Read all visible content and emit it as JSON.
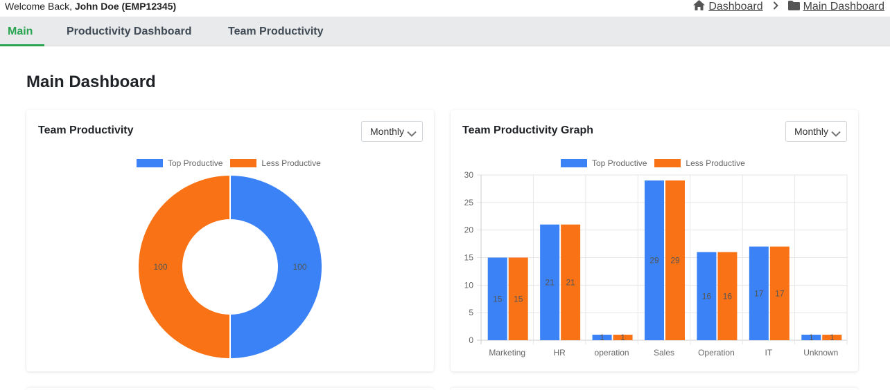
{
  "topbar": {
    "welcome_prefix": "Welcome Back,",
    "user": "John Doe (EMP12345)",
    "breadcrumb": [
      {
        "label": "Dashboard",
        "icon": "home-icon"
      },
      {
        "label": "Main Dashboard",
        "icon": "folder-icon"
      }
    ]
  },
  "tabs": [
    {
      "label": "Main",
      "active": true
    },
    {
      "label": "Productivity Dashboard",
      "active": false
    },
    {
      "label": "Team Productivity",
      "active": false
    }
  ],
  "page_title": "Main Dashboard",
  "colors": {
    "top": "#3b82f6",
    "less": "#f97316",
    "accent": "#2aa450"
  },
  "cards": {
    "donut": {
      "title": "Team Productivity",
      "period": "Monthly"
    },
    "bars": {
      "title": "Team Productivity Graph",
      "period": "Monthly"
    }
  },
  "chart_data": [
    {
      "type": "pie",
      "variant": "doughnut",
      "legend": [
        "Top Productive",
        "Less Productive"
      ],
      "legend_position": "top",
      "labels": [
        "Top Productive",
        "Less Productive"
      ],
      "values": [
        100,
        100
      ],
      "colors": [
        "#3b82f6",
        "#f97316"
      ]
    },
    {
      "type": "bar",
      "legend_position": "top",
      "categories": [
        "Marketing",
        "HR",
        "operation",
        "Sales",
        "Operation",
        "IT",
        "Unknown"
      ],
      "series": [
        {
          "name": "Top Productive",
          "color": "#3b82f6",
          "values": [
            15,
            21,
            1,
            29,
            16,
            17,
            1
          ]
        },
        {
          "name": "Less Productive",
          "color": "#f97316",
          "values": [
            15,
            21,
            1,
            29,
            16,
            17,
            1
          ]
        }
      ],
      "yticks": [
        0,
        5,
        10,
        15,
        20,
        25,
        30
      ],
      "ylim": [
        0,
        30
      ],
      "grid": true
    }
  ]
}
